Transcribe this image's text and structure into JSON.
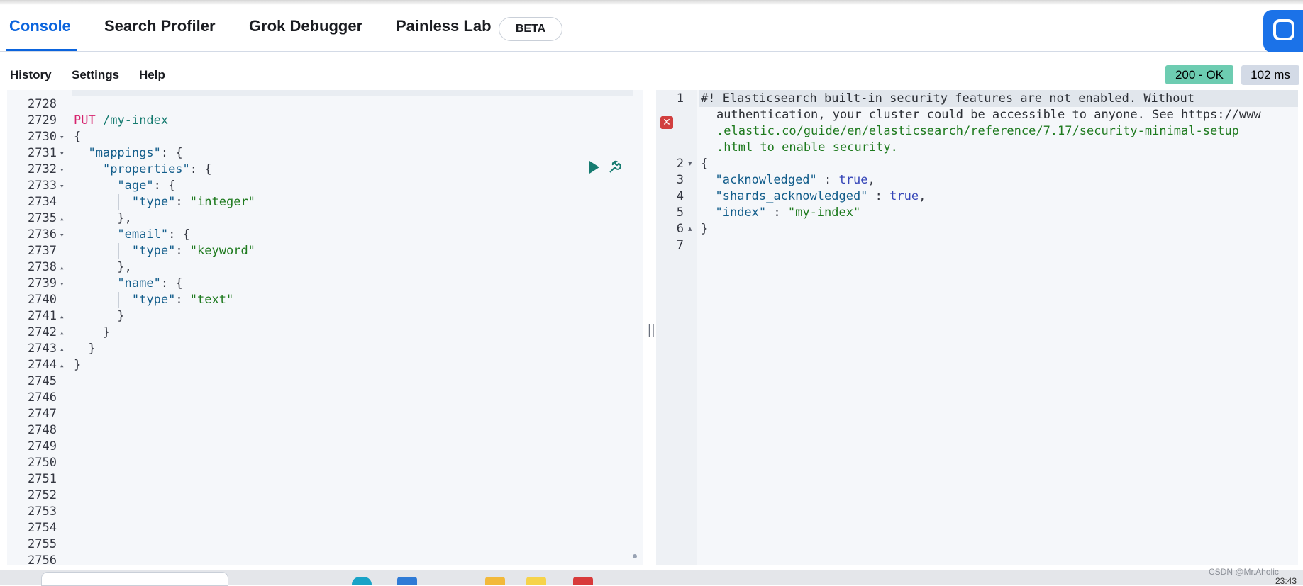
{
  "tabs": [
    {
      "label": "Console",
      "active": true
    },
    {
      "label": "Search Profiler",
      "active": false
    },
    {
      "label": "Grok Debugger",
      "active": false
    },
    {
      "label": "Painless Lab",
      "active": false
    }
  ],
  "beta_label": "BETA",
  "toolbar": {
    "history": "History",
    "settings": "Settings",
    "help": "Help",
    "status": "200 - OK",
    "duration": "102 ms"
  },
  "request_editor": {
    "line_numbers": [
      "2728",
      "2729",
      "2730",
      "2731",
      "2732",
      "2733",
      "2734",
      "2735",
      "2736",
      "2737",
      "2738",
      "2739",
      "2740",
      "2741",
      "2742",
      "2743",
      "2744",
      "2745",
      "2746",
      "2747",
      "2748",
      "2749",
      "2750",
      "2751",
      "2752",
      "2753",
      "2754",
      "2755",
      "2756"
    ],
    "method": "PUT",
    "path": "/my-index",
    "open_brace": "{",
    "mappings_key": "\"mappings\"",
    "properties_key": "\"properties\"",
    "age_key": "\"age\"",
    "email_key": "\"email\"",
    "name_key": "\"name\"",
    "type_key": "\"type\"",
    "integer_val": "\"integer\"",
    "keyword_val": "\"keyword\"",
    "text_val": "\"text\""
  },
  "response_editor": {
    "line_numbers": [
      "1",
      "2",
      "3",
      "4",
      "5",
      "6",
      "7"
    ],
    "warning_line1": "#! Elasticsearch built-in security features are not enabled. Without",
    "warning_line2": "authentication, your cluster could be accessible to anyone. See https://www",
    "warning_line3": ".elastic.co/guide/en/elasticsearch/reference/7.17/security-minimal-setup",
    "warning_line4": ".html to enable security.",
    "acknowledged_key": "\"acknowledged\"",
    "shards_key": "\"shards_acknowledged\"",
    "index_key": "\"index\"",
    "true_val": "true",
    "index_val": "\"my-index\""
  },
  "footer": {
    "watermark": "CSDN @Mr.Aholic",
    "clock": "23:43"
  },
  "colors": {
    "accent": "#0b64dd",
    "status_ok": "#6dccb1"
  }
}
